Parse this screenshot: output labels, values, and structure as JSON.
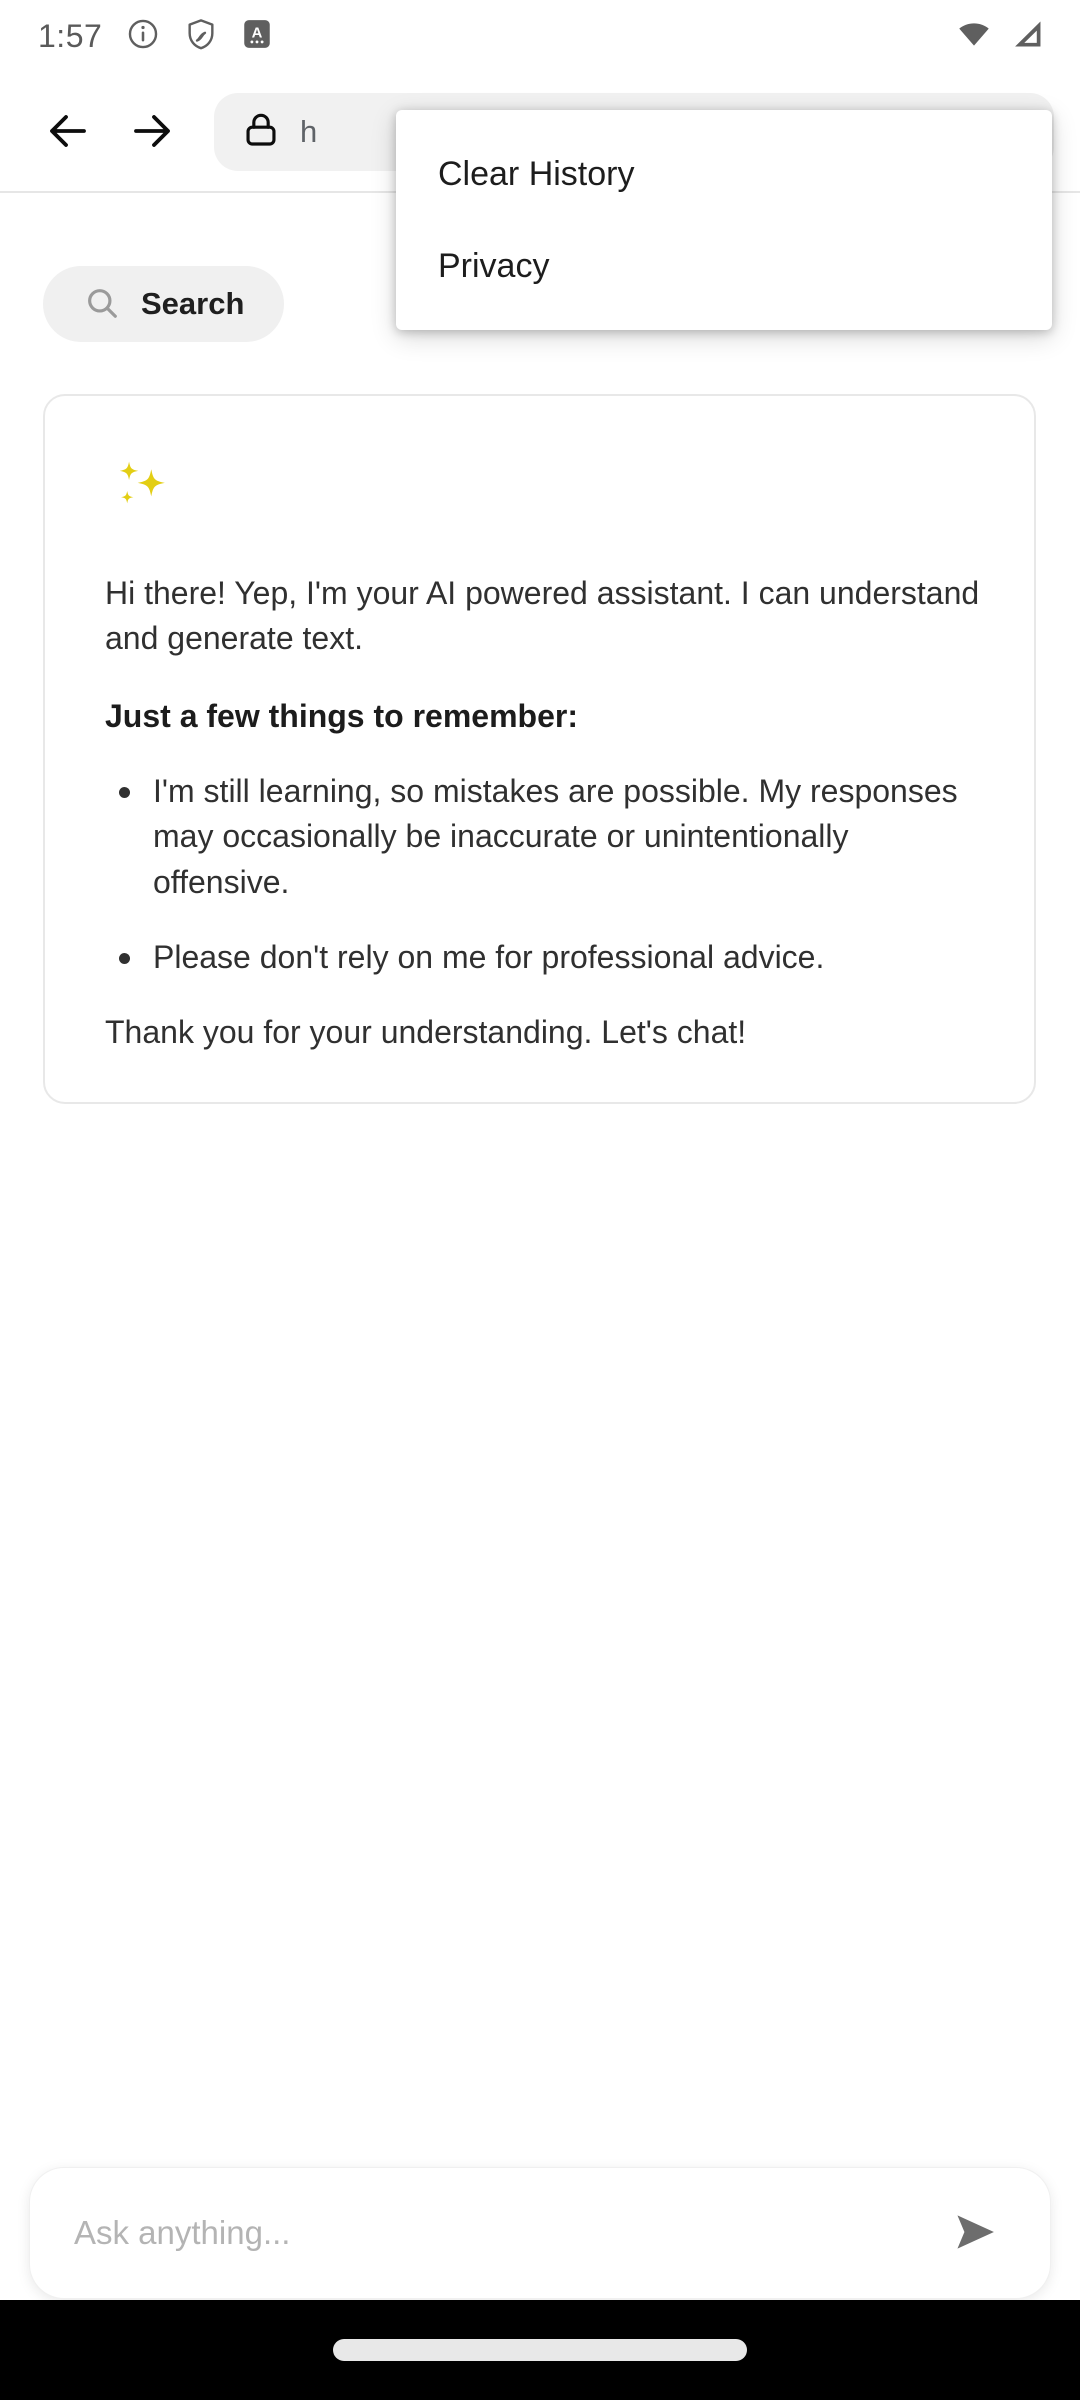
{
  "status_bar": {
    "time": "1:57",
    "left_icons": [
      "info-icon",
      "shield-icon",
      "a-badge-icon"
    ],
    "right_icons": [
      "wifi-icon",
      "cellular-signal-icon"
    ]
  },
  "browser": {
    "back_label": "back-arrow-icon",
    "forward_label": "forward-arrow-icon",
    "url_lock": "lock-icon",
    "url_text": "h"
  },
  "overflow_menu": {
    "items": [
      {
        "label": "Clear History"
      },
      {
        "label": "Privacy"
      }
    ]
  },
  "search": {
    "label": "Search",
    "icon": "search-icon"
  },
  "assistant_card": {
    "icon": "sparkles-icon",
    "greeting": "Hi there! Yep, I'm your AI powered assistant. I can understand and generate text.",
    "remember_heading": "Just a few things to remember:",
    "remember_items": [
      "I'm still learning, so mistakes are possible. My responses may occasionally be inaccurate or unintentionally offensive.",
      "Please don't rely on me for professional advice."
    ],
    "closing": "Thank you for your understanding. Let's chat!"
  },
  "composer": {
    "placeholder": "Ask anything...",
    "value": "",
    "send_icon": "send-icon"
  },
  "colors": {
    "sparkle": "#E3CE14",
    "chip_bg": "#f0f0f0",
    "text": "#303030",
    "nav_bar": "#000000"
  }
}
